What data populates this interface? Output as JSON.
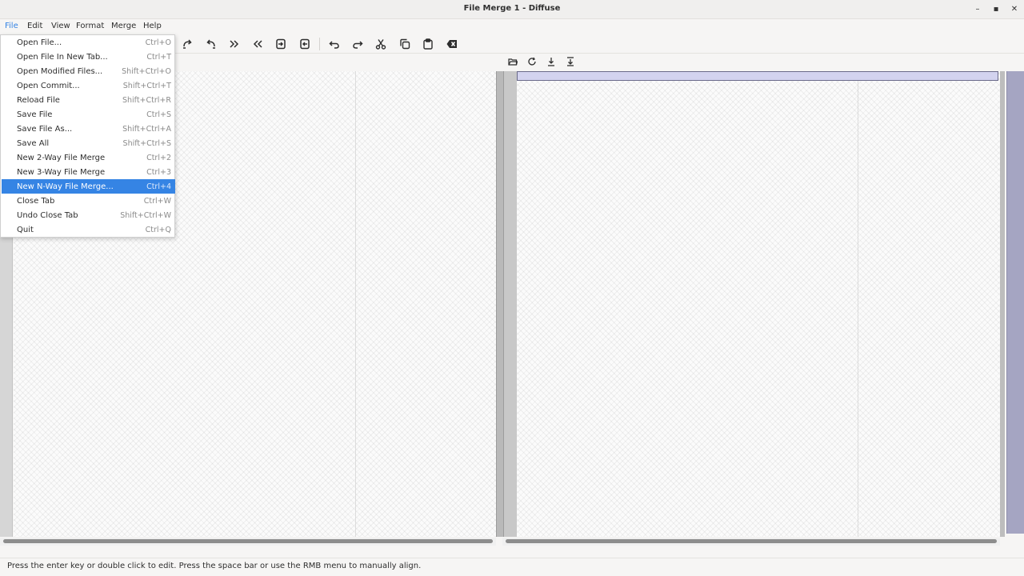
{
  "window": {
    "title": "File Merge 1 - Diffuse",
    "controls": [
      "–",
      "▪",
      "✕"
    ]
  },
  "menubar": {
    "items": [
      "File",
      "Edit",
      "View",
      "Format",
      "Merge",
      "Help"
    ],
    "active": "File"
  },
  "toolbar": {
    "buttons": [
      "realign-icon",
      "isolate-icon",
      "merge-from-left-icon",
      "merge-from-right-icon",
      "merge-left-then-right-icon",
      "merge-right-then-left-icon",
      "undo-icon",
      "redo-icon",
      "cut-icon",
      "copy-icon",
      "paste-icon",
      "clear-edits-icon"
    ]
  },
  "pane_toolbar": {
    "buttons": [
      "open-file-icon",
      "reload-icon",
      "save-icon",
      "save-as-icon"
    ]
  },
  "file_menu": {
    "items": [
      {
        "label": "Open File...",
        "shortcut": "Ctrl+O"
      },
      {
        "label": "Open File In New Tab...",
        "shortcut": "Ctrl+T"
      },
      {
        "label": "Open Modified Files...",
        "shortcut": "Shift+Ctrl+O"
      },
      {
        "label": "Open Commit...",
        "shortcut": "Shift+Ctrl+T"
      },
      {
        "label": "Reload File",
        "shortcut": "Shift+Ctrl+R"
      },
      {
        "label": "Save File",
        "shortcut": "Ctrl+S"
      },
      {
        "label": "Save File As...",
        "shortcut": "Shift+Ctrl+A"
      },
      {
        "label": "Save All",
        "shortcut": "Shift+Ctrl+S"
      },
      {
        "label": "New 2-Way File Merge",
        "shortcut": "Ctrl+2"
      },
      {
        "label": "New 3-Way File Merge",
        "shortcut": "Ctrl+3"
      },
      {
        "label": "New N-Way File Merge...",
        "shortcut": "Ctrl+4"
      },
      {
        "label": "Close Tab",
        "shortcut": "Ctrl+W"
      },
      {
        "label": "Undo Close Tab",
        "shortcut": "Shift+Ctrl+W"
      },
      {
        "label": "Quit",
        "shortcut": "Ctrl+Q"
      }
    ],
    "highlighted": "New N-Way File Merge..."
  },
  "status": {
    "message": "Press the enter key or double click to edit. Press the space bar or use the RMB menu to manually align."
  },
  "colors": {
    "accent": "#3584e4",
    "overview": "#a5a5c2",
    "cursor_line": "#d3d3ef"
  }
}
